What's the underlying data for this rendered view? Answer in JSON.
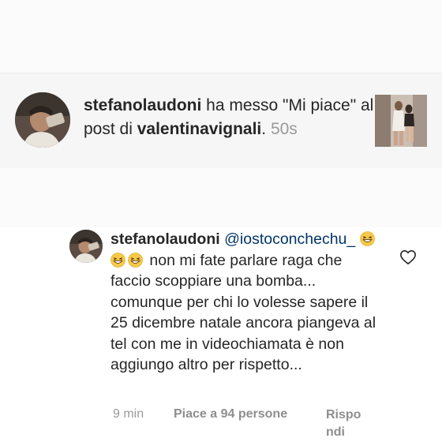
{
  "notification": {
    "username": "stefanolaudoni",
    "action_text": " ha messo \"Mi piace\" al post di ",
    "target_user": "valentinavignali",
    "separator": ". ",
    "time": "50s"
  },
  "comment": {
    "username": "stefanolaudoni",
    "mention": "@iostoconchechu_",
    "emoji": [
      "grinning-squinting-face-emoji",
      "grinning-squinting-face-emoji",
      "grinning-squinting-face-emoji"
    ],
    "text": " non mi fate parlare raga che faccio scoppiare una bomba... comunque per chi lo volesse sapere il 25 dicembre natale ancora piangeva al tel con me in videochiamata è non aggiungo altro per rispetto...",
    "time": "9 min",
    "likes": "Piace a 94 persone",
    "reply": "Rispondi"
  },
  "colors": {
    "mention": "#003569",
    "meta": "#9a9a9a",
    "notification_bg": "#f6f6f6"
  }
}
